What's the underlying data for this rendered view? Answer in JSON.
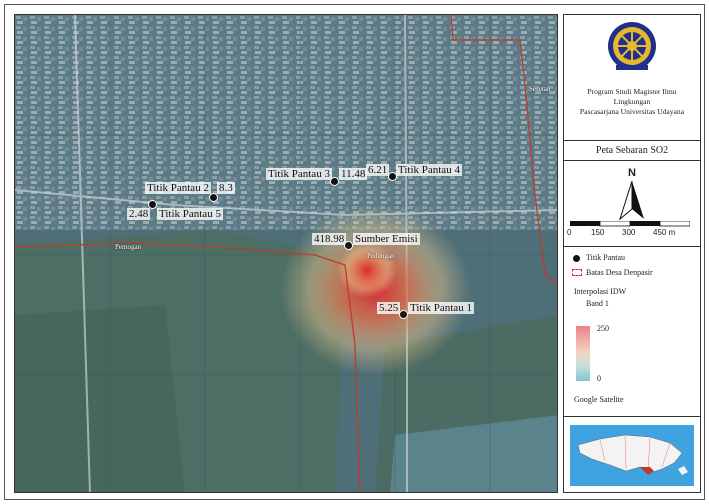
{
  "map": {
    "points": [
      {
        "name": "Titik Pantau 1",
        "value": "5.25"
      },
      {
        "name": "Titik Pantau 2",
        "value": "8.3"
      },
      {
        "name": "Titik Pantau 3",
        "value": "11.48"
      },
      {
        "name": "Titik Pantau 4",
        "value": "6.21"
      },
      {
        "name": "Titik Pantau 5",
        "value": "2.48"
      },
      {
        "name": "Sumber Emisi",
        "value": "418.98"
      }
    ],
    "places": [
      "Pemogan",
      "Pedungan",
      "Sesetan"
    ]
  },
  "panel": {
    "org_line1": "Program Studi Magister Ilmu",
    "org_line2": "Lingkungan",
    "org_line3": "Pascasarjana Universitas Udayana",
    "title": "Peta Sebaran SO2",
    "north": "N",
    "scale": [
      "0",
      "150",
      "300",
      "450 m"
    ],
    "legend": {
      "point": "Titik Pantau",
      "boundary": "Batas Desa Denpasir",
      "interp_title": "Interpolasi IDW",
      "band": "Band 1",
      "max": "250",
      "min": "0",
      "basemap": "Google Satelite"
    }
  },
  "colors": {
    "boundary": "#c0392b",
    "ramp_high": "#f0808a",
    "ramp_low": "#87c0d6"
  }
}
